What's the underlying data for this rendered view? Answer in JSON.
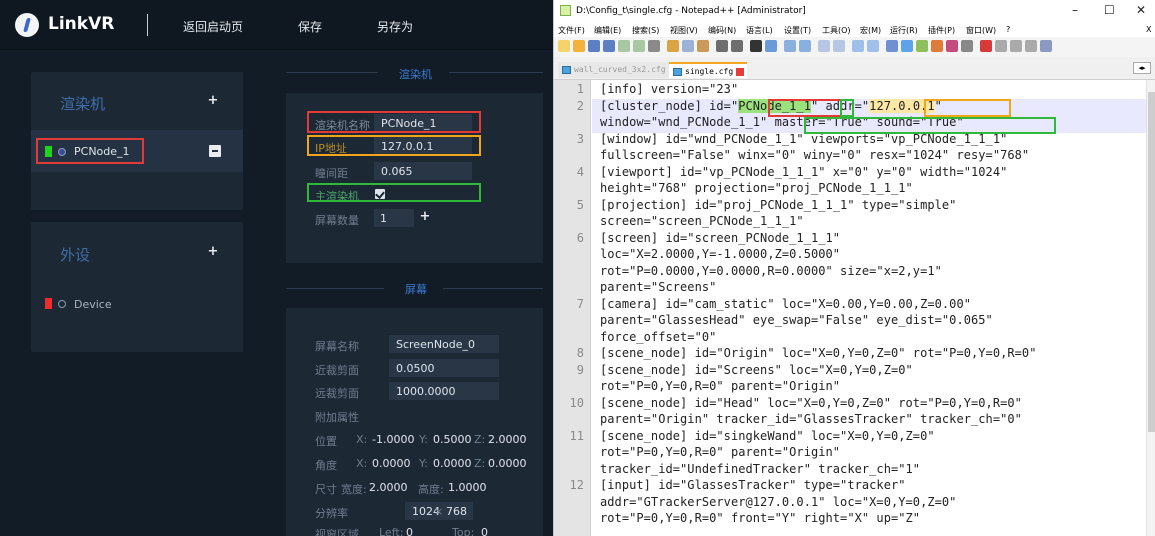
{
  "linkvr": {
    "logo_text": "LinkVR",
    "menu": [
      "返回启动页",
      "保存",
      "另存为"
    ],
    "renderer_card": {
      "title": "渲染机",
      "nodes": [
        {
          "name": "PCNode_1",
          "color": "#1fd31f"
        }
      ]
    },
    "peripheral_card": {
      "title": "外设",
      "devices": [
        {
          "name": "Device",
          "color": "#ef2b2b"
        }
      ]
    },
    "renderer_panel": {
      "section_title": "渲染机",
      "name_label": "渲染机名称",
      "name_value": "PCNode_1",
      "ip_label": "IP地址",
      "ip_value": "127.0.0.1",
      "eye_label": "瞳间距",
      "eye_value": "0.065",
      "master_label": "主渲染机",
      "screen_count_label": "屏幕数量",
      "screen_count_value": "1"
    },
    "screen_panel": {
      "section_title": "屏幕",
      "screen_name_label": "屏幕名称",
      "screen_name_value": "ScreenNode_0",
      "near_label": "近裁剪面",
      "near_value": "0.0500",
      "far_label": "远裁剪面",
      "far_value": "1000.0000",
      "extra_label": "附加属性",
      "pos_label": "位置",
      "pos": {
        "x_key": "X:",
        "x": "-1.0000",
        "y_key": "Y:",
        "y": "0.5000",
        "z_key": "Z:",
        "z": "2.0000"
      },
      "rot_label": "角度",
      "rot": {
        "x_key": "X:",
        "x": "0.0000",
        "y_key": "Y:",
        "y": "0.0000",
        "z_key": "Z:",
        "z": "0.0000"
      },
      "size_label": "尺寸",
      "size": {
        "w_key": "宽度:",
        "w": "2.0000",
        "h_key": "高度:",
        "h": "1.0000"
      },
      "res_label": "分辨率",
      "res_w": "1024",
      "res_sep": "×",
      "res_h": "768",
      "viewport_label": "视窗区域",
      "viewport": {
        "left_key": "Left:",
        "left": "0",
        "top_key": "Top:",
        "top": "0"
      }
    }
  },
  "notepad": {
    "title": "D:\\Config_t\\single.cfg - Notepad++ [Administrator]",
    "window_buttons": [
      "–",
      "☐",
      "✕"
    ],
    "menu": [
      "文件(F)",
      "编辑(E)",
      "搜索(S)",
      "视图(V)",
      "编码(N)",
      "语言(L)",
      "设置(T)",
      "工具(O)",
      "宏(M)",
      "运行(R)",
      "插件(P)",
      "窗口(W)",
      "?",
      "X"
    ],
    "tabs": [
      "wall_curved_3x2.cfg",
      "single.cfg"
    ],
    "lines": [
      {
        "n": "1",
        "text": "[info] version=\"23\""
      },
      {
        "n": "2",
        "pre": "[cluster_node] id=\"",
        "id": "PCNode_1_1",
        "mid": "\" addr=\"",
        "addr": "127.0.0.1",
        "post": "\""
      },
      {
        "n": "",
        "pre": "window=\"wnd_PCNode_1_1\" ",
        "master": "master=\"True\" sound=\"True\""
      },
      {
        "n": "3",
        "text": "[window] id=\"wnd_PCNode_1_1\" viewports=\"vp_PCNode_1_1_1\""
      },
      {
        "n": "",
        "text": "fullscreen=\"False\" winx=\"0\" winy=\"0\" resx=\"1024\" resy=\"768\""
      },
      {
        "n": "4",
        "text": "[viewport] id=\"vp_PCNode_1_1_1\" x=\"0\" y=\"0\" width=\"1024\""
      },
      {
        "n": "",
        "text": "height=\"768\" projection=\"proj_PCNode_1_1_1\""
      },
      {
        "n": "5",
        "text": "[projection] id=\"proj_PCNode_1_1_1\" type=\"simple\""
      },
      {
        "n": "",
        "text": "screen=\"screen_PCNode_1_1_1\""
      },
      {
        "n": "6",
        "text": "[screen] id=\"screen_PCNode_1_1_1\""
      },
      {
        "n": "",
        "text": "loc=\"X=2.0000,Y=-1.0000,Z=0.5000\""
      },
      {
        "n": "",
        "text": "rot=\"P=0.0000,Y=0.0000,R=0.0000\" size=\"x=2,y=1\""
      },
      {
        "n": "",
        "text": "parent=\"Screens\""
      },
      {
        "n": "7",
        "text": "[camera] id=\"cam_static\" loc=\"X=0.00,Y=0.00,Z=0.00\""
      },
      {
        "n": "",
        "text": "parent=\"GlassesHead\" eye_swap=\"False\" eye_dist=\"0.065\""
      },
      {
        "n": "",
        "text": "force_offset=\"0\""
      },
      {
        "n": "8",
        "text": "[scene_node] id=\"Origin\" loc=\"X=0,Y=0,Z=0\" rot=\"P=0,Y=0,R=0\""
      },
      {
        "n": "9",
        "text": "[scene_node] id=\"Screens\" loc=\"X=0,Y=0,Z=0\""
      },
      {
        "n": "",
        "text": "rot=\"P=0,Y=0,R=0\" parent=\"Origin\""
      },
      {
        "n": "10",
        "text": "[scene_node] id=\"Head\" loc=\"X=0,Y=0,Z=0\" rot=\"P=0,Y=0,R=0\""
      },
      {
        "n": "",
        "text": "parent=\"Origin\" tracker_id=\"GlassesTracker\" tracker_ch=\"0\""
      },
      {
        "n": "11",
        "text": "[scene_node] id=\"singkeWand\" loc=\"X=0,Y=0,Z=0\""
      },
      {
        "n": "",
        "text": "rot=\"P=0,Y=0,R=0\" parent=\"Origin\""
      },
      {
        "n": "",
        "text": "tracker_id=\"UndefinedTracker\" tracker_ch=\"1\""
      },
      {
        "n": "12",
        "text": "[input] id=\"GlassesTracker\" type=\"tracker\""
      },
      {
        "n": "",
        "text": "addr=\"GTrackerServer@127.0.0.1\" loc=\"X=0,Y=0,Z=0\""
      },
      {
        "n": "",
        "text": "rot=\"P=0,Y=0,R=0\" front=\"Y\" right=\"X\" up=\"Z\""
      }
    ]
  }
}
